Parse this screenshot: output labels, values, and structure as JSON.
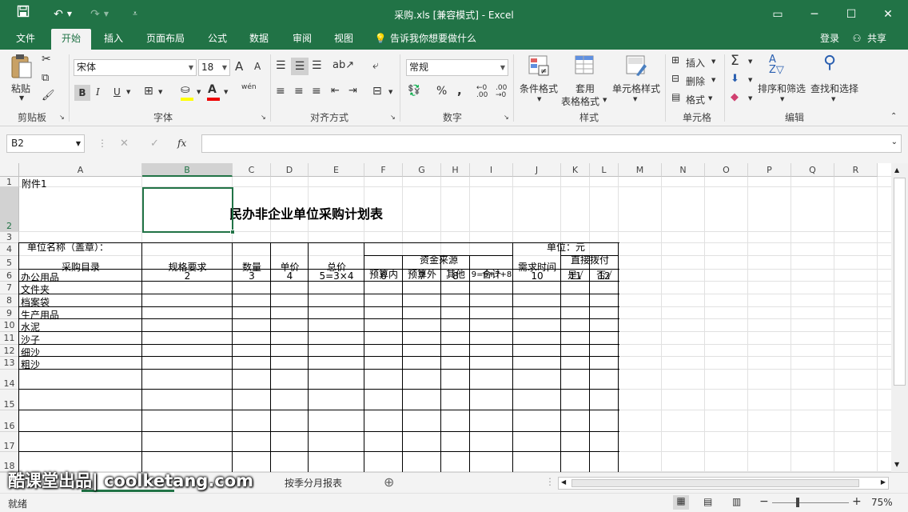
{
  "window": {
    "title": "采购.xls  [兼容模式] - Excel"
  },
  "tabs": [
    "文件",
    "开始",
    "插入",
    "页面布局",
    "公式",
    "数据",
    "审阅",
    "视图"
  ],
  "active_tab": "开始",
  "tell_me": "告诉我你想要做什么",
  "account": {
    "login": "登录",
    "share": "共享"
  },
  "ribbon": {
    "clipboard": {
      "paste": "粘贴",
      "label": "剪贴板"
    },
    "font": {
      "name": "宋体",
      "size": "18",
      "label": "字体",
      "bold": "B",
      "italic": "I",
      "underline": "U",
      "grow": "A",
      "shrink": "A",
      "phonetic": "wén"
    },
    "alignment": {
      "label": "对齐方式"
    },
    "number": {
      "format": "常规",
      "label": "数字",
      "percent": "%",
      "comma": ","
    },
    "styles": {
      "conditional": "条件格式",
      "table_line1": "套用",
      "table_line2": "表格格式",
      "cell_styles": "单元格样式",
      "label": "样式"
    },
    "cells": {
      "insert": "插入",
      "delete": "删除",
      "format": "格式",
      "label": "单元格"
    },
    "editing": {
      "sort": "排序和筛选",
      "find": "查找和选择",
      "label": "编辑"
    }
  },
  "formula_bar": {
    "name_box": "B2",
    "fx": "fx",
    "content": ""
  },
  "columns": [
    "A",
    "B",
    "C",
    "D",
    "E",
    "F",
    "G",
    "H",
    "I",
    "J",
    "K",
    "L",
    "M",
    "N",
    "O",
    "P",
    "Q",
    "R"
  ],
  "selected_column": "B",
  "rows": [
    "1",
    "2",
    "3",
    "4",
    "5",
    "6",
    "7",
    "8",
    "9",
    "10",
    "11",
    "12",
    "13",
    "14",
    "15",
    "16",
    "17",
    "18"
  ],
  "selected_row": "2",
  "sheet": {
    "a1": "附件1",
    "title": "民办非企业单位采购计划表",
    "unit_name": "单位名称（盖章）：",
    "unit": "单位：元",
    "headers": {
      "catalog": "采购目录",
      "spec": "规格要求",
      "qty": "数量",
      "price": "单价",
      "total": "总价",
      "fund_source": "资金来源",
      "budget_in": "预算内",
      "budget_out": "预算外",
      "other": "其他",
      "sum": "合计",
      "need_time": "需求时间",
      "direct": "直接拨付",
      "yes": "是√",
      "no": "否√"
    },
    "row6": [
      "办公用品",
      "2",
      "3",
      "4",
      "5=3×4",
      "6",
      "7",
      "8",
      "9=6+7+8",
      "10",
      "11",
      "12"
    ],
    "items": [
      "文件夹",
      "档案袋",
      "生产用品",
      "水泥",
      "沙子",
      "细沙",
      "粗沙"
    ]
  },
  "sheet_tabs": {
    "other": "按季分月报表"
  },
  "status": {
    "ready": "就绪",
    "zoom": "75%"
  },
  "watermark": "酷课堂出品| coolketang.com"
}
